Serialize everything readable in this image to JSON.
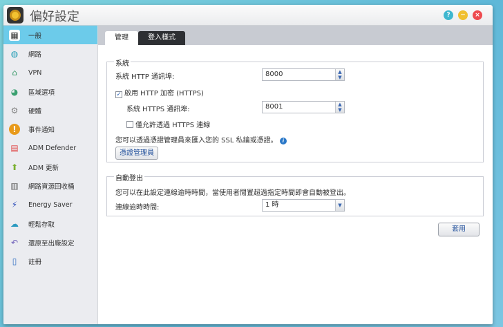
{
  "window": {
    "title": "偏好設定",
    "help": "?",
    "minimize": "−",
    "close": "×"
  },
  "sidebar": {
    "items": [
      {
        "label": "一般",
        "icon": "nas-icon"
      },
      {
        "label": "網路",
        "icon": "globe-icon"
      },
      {
        "label": "VPN",
        "icon": "house-network-icon"
      },
      {
        "label": "區域選項",
        "icon": "region-icon"
      },
      {
        "label": "硬體",
        "icon": "hardware-icon"
      },
      {
        "label": "事件通知",
        "icon": "alert-icon"
      },
      {
        "label": "ADM Defender",
        "icon": "firewall-icon"
      },
      {
        "label": "ADM 更新",
        "icon": "update-arrow-icon"
      },
      {
        "label": "網路資源回收桶",
        "icon": "trash-icon"
      },
      {
        "label": "Energy Saver",
        "icon": "energy-icon"
      },
      {
        "label": "輕鬆存取",
        "icon": "cloud-icon"
      },
      {
        "label": "還原至出廠設定",
        "icon": "restore-icon"
      },
      {
        "label": "註冊",
        "icon": "register-icon"
      }
    ]
  },
  "tabs": [
    "管理",
    "登入樣式"
  ],
  "system": {
    "legend": "系統",
    "http_label": "系統 HTTP 通訊埠:",
    "http_value": "8000",
    "https_enable": "啟用 HTTP 加密 (HTTPS)",
    "https_label": "系統 HTTPS 通訊埠:",
    "https_value": "8001",
    "https_only": "僅允許透過 HTTPS 連線",
    "ssl_text": "您可以透過憑證管理員來匯入您的 SSL 私鑰或憑證。",
    "cert_button": "憑證管理員"
  },
  "logout": {
    "legend": "自動登出",
    "desc": "您可以在此設定連線逾時時間，當使用者閒置超過指定時間即會自動被登出。",
    "timeout_label": "連線逾時時間:",
    "timeout_value": "1 時"
  },
  "apply": "套用"
}
